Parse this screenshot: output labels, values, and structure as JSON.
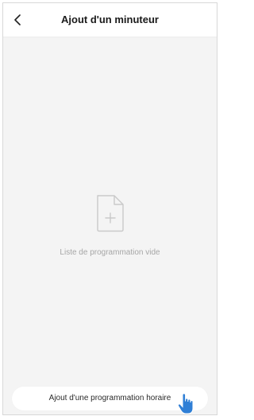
{
  "header": {
    "back_icon": "chevron-left-icon",
    "title": "Ajout d'un minuteur"
  },
  "empty_state": {
    "icon": "document-add-icon",
    "message": "Liste de programmation vide"
  },
  "footer": {
    "add_button_label": "Ajout d'une programmation horaire"
  },
  "cursor": {
    "icon": "hand-pointer-icon",
    "color": "#2f7fd6"
  },
  "colors": {
    "background": "#f4f4f4",
    "header": "#ffffff",
    "muted_text": "#a6a6a6",
    "icon_gray": "#c9c9c9"
  }
}
